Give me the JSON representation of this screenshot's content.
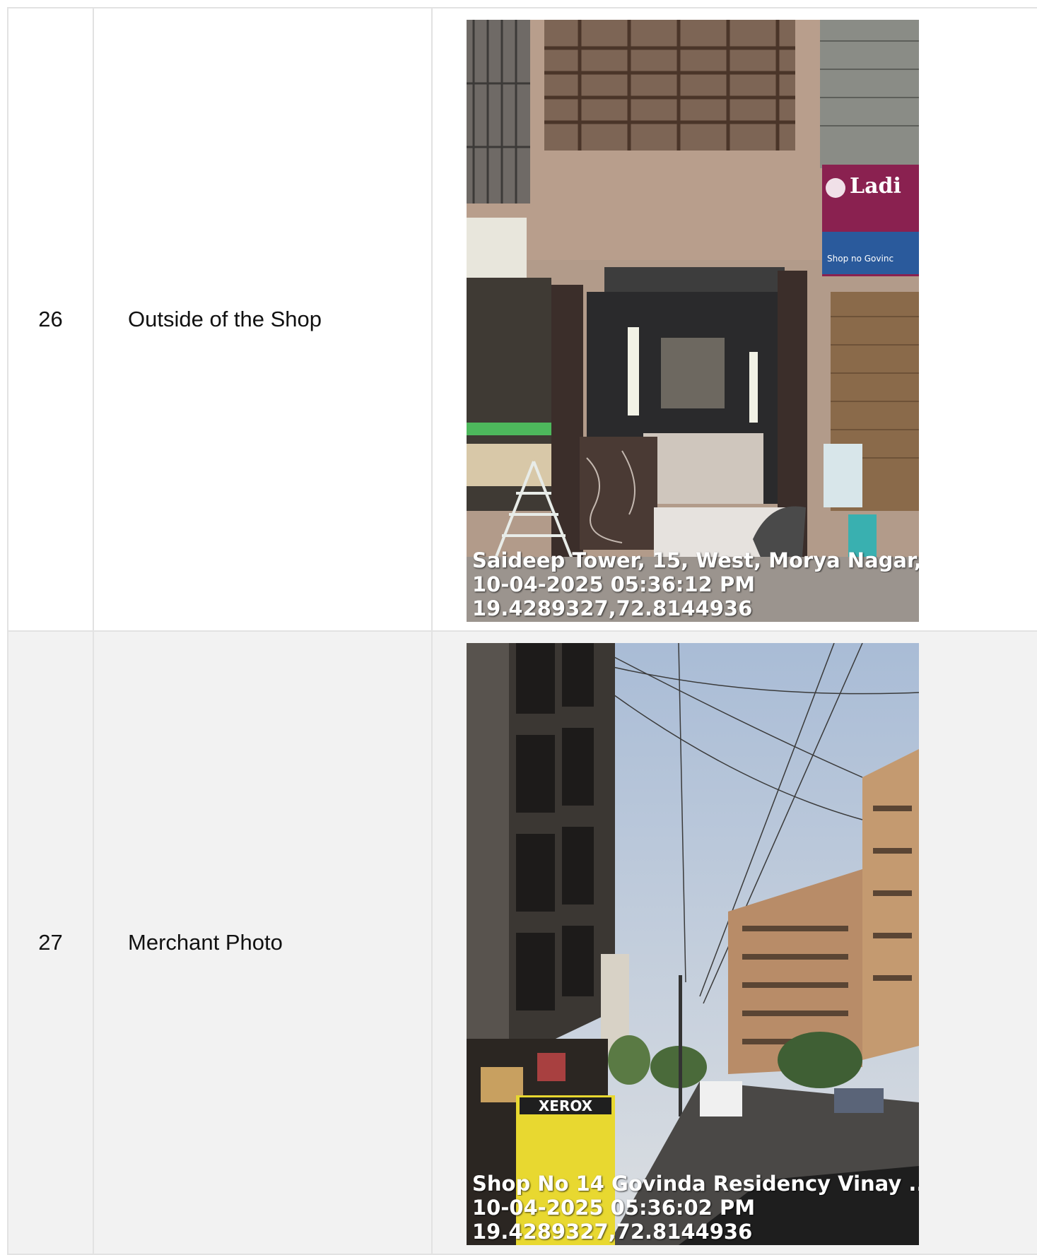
{
  "rows": [
    {
      "number": "26",
      "label": "Outside of the Shop",
      "photo": {
        "address": "Saideep Tower, 15, West, Morya Nagar, ...",
        "datetime": "10-04-2025 05:36:12 PM",
        "coordinates": "19.4289327,72.8144936",
        "sign_text": "Ladi",
        "sign_subtext": "Shop no    Govinc"
      }
    },
    {
      "number": "27",
      "label": "Merchant Photo",
      "photo": {
        "address": "Shop No 14 Govinda Residency Vinay ...",
        "datetime": "10-04-2025 05:36:02 PM",
        "coordinates": "19.4289327,72.8144936",
        "sign_text": "XEROX"
      }
    }
  ]
}
